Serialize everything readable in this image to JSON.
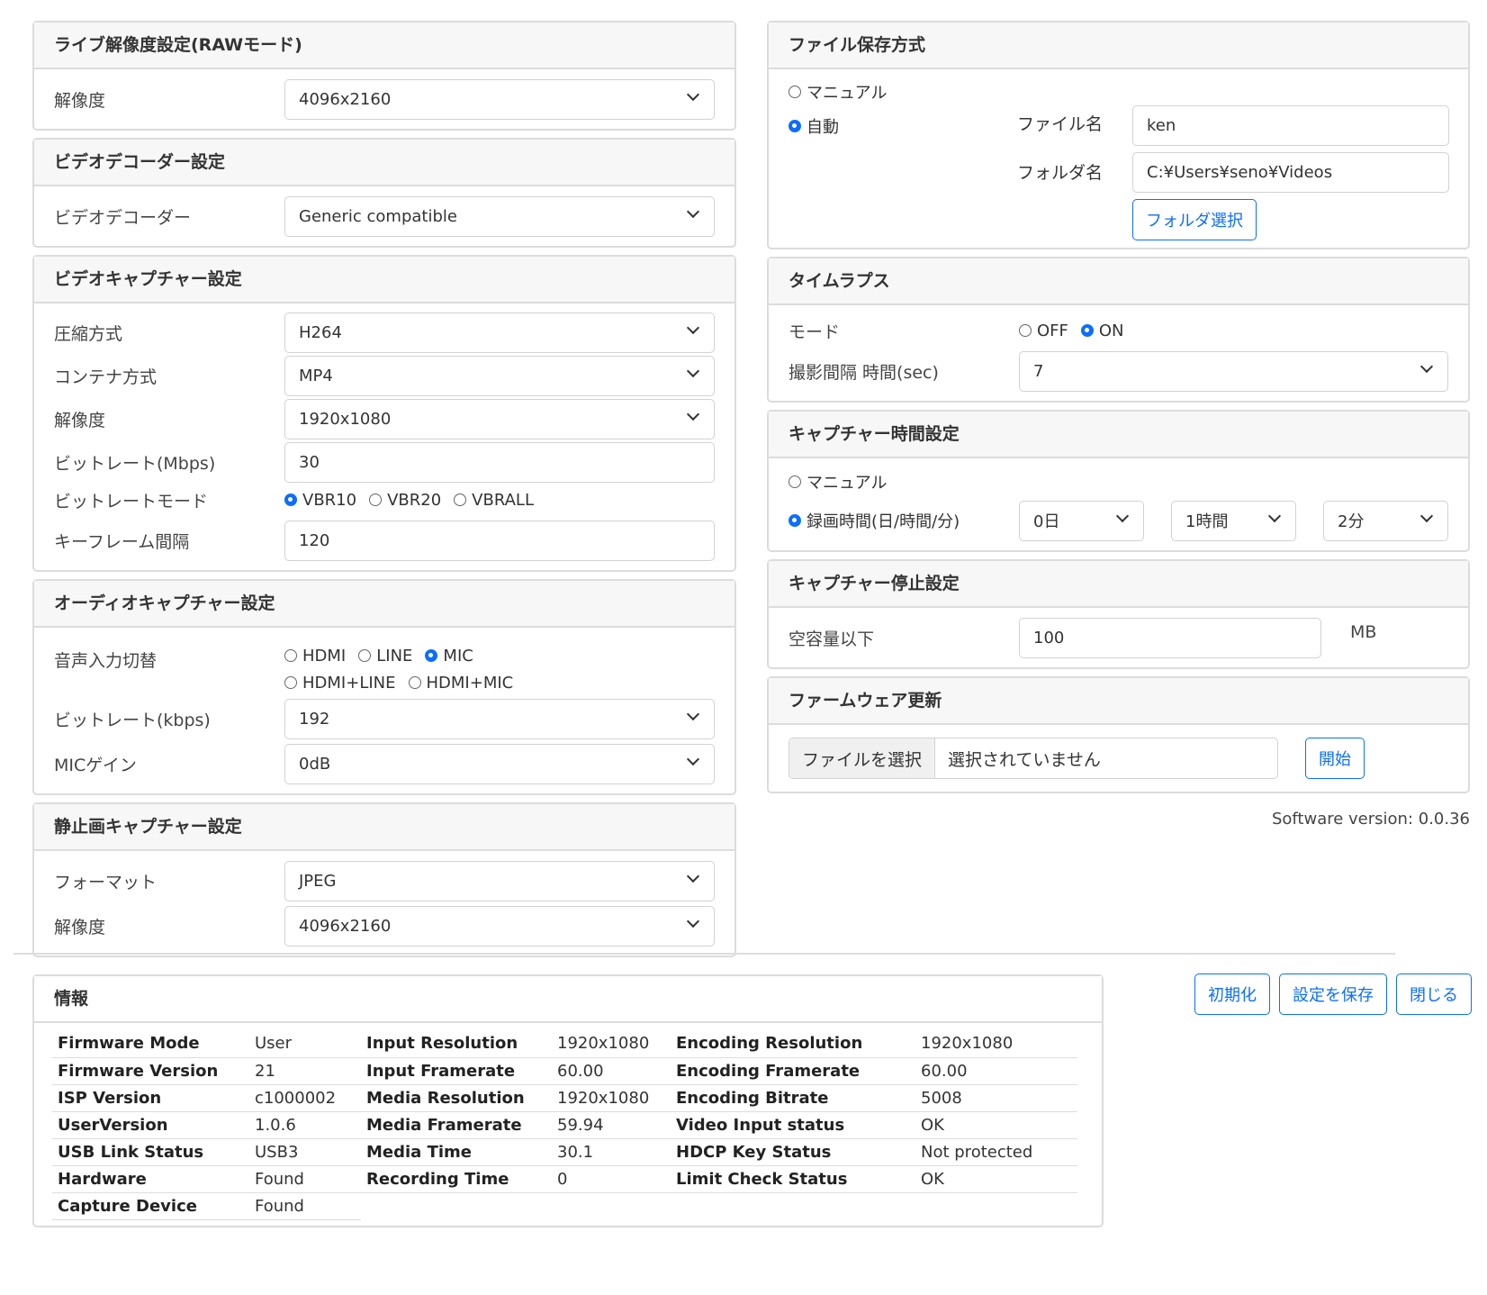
{
  "raw": {
    "title": "ライブ解像度設定(RAWモード)",
    "res_label": "解像度",
    "res_value": "4096x2160"
  },
  "decoder": {
    "title": "ビデオデコーダー設定",
    "label": "ビデオデコーダー",
    "value": "Generic compatible"
  },
  "vcap": {
    "title": "ビデオキャプチャー設定",
    "compression_label": "圧縮方式",
    "compression_value": "H264",
    "container_label": "コンテナ方式",
    "container_value": "MP4",
    "res_label": "解像度",
    "res_value": "1920x1080",
    "bitrate_label": "ビットレート(Mbps)",
    "bitrate_value": "30",
    "mode_label": "ビットレートモード",
    "mode_options": [
      "VBR10",
      "VBR20",
      "VBRALL"
    ],
    "keyframe_label": "キーフレーム間隔",
    "keyframe_value": "120"
  },
  "acap": {
    "title": "オーディオキャプチャー設定",
    "input_label": "音声入力切替",
    "inputs": [
      "HDMI",
      "LINE",
      "MIC",
      "HDMI+LINE",
      "HDMI+MIC"
    ],
    "bitrate_label": "ビットレート(kbps)",
    "bitrate_value": "192",
    "gain_label": "MICゲイン",
    "gain_value": "0dB"
  },
  "still": {
    "title": "静止画キャプチャー設定",
    "format_label": "フォーマット",
    "format_value": "JPEG",
    "res_label": "解像度",
    "res_value": "4096x2160"
  },
  "filesave": {
    "title": "ファイル保存方式",
    "manual": "マニュアル",
    "auto": "自動",
    "filename_label": "ファイル名",
    "filename_value": "ken",
    "folder_label": "フォルダ名",
    "folder_value": "C:¥Users¥seno¥Videos",
    "folder_button": "フォルダ選択"
  },
  "timelapse": {
    "title": "タイムラプス",
    "mode_label": "モード",
    "off": "OFF",
    "on": "ON",
    "interval_label": "撮影間隔 時間(sec)",
    "interval_value": "7"
  },
  "captime": {
    "title": "キャプチャー時間設定",
    "manual": "マニュアル",
    "rec_label": "録画時間(日/時間/分)",
    "day": "0日",
    "hour": "1時間",
    "minute": "2分"
  },
  "capstop": {
    "title": "キャプチャー停止設定",
    "label": "空容量以下",
    "value": "100",
    "unit": "MB"
  },
  "firmware": {
    "title": "ファームウェア更新",
    "choose": "ファイルを選択",
    "none": "選択されていません",
    "start": "開始"
  },
  "version": "Software version: 0.0.36",
  "info": {
    "title": "情報",
    "rows": [
      [
        "Firmware Mode",
        "User",
        "Input Resolution",
        "1920x1080",
        "Encoding Resolution",
        "1920x1080"
      ],
      [
        "Firmware Version",
        "21",
        "Input Framerate",
        "60.00",
        "Encoding Framerate",
        "60.00"
      ],
      [
        "ISP Version",
        "c1000002",
        "Media Resolution",
        "1920x1080",
        "Encoding Bitrate",
        "5008"
      ],
      [
        "UserVersion",
        "1.0.6",
        "Media Framerate",
        "59.94",
        "Video Input status",
        "OK"
      ],
      [
        "USB Link Status",
        "USB3",
        "Media Time",
        "30.1",
        "HDCP Key Status",
        "Not protected"
      ],
      [
        "Hardware",
        "Found",
        "Recording Time",
        "0",
        "Limit Check Status",
        "OK"
      ],
      [
        "Capture Device",
        "Found",
        "",
        "",
        "",
        ""
      ]
    ]
  },
  "actions": {
    "init": "初期化",
    "save": "設定を保存",
    "close": "閉じる"
  }
}
